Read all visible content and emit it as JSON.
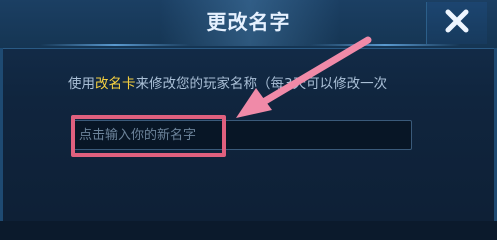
{
  "dialog": {
    "title": "更改名字",
    "close_icon": "close-icon",
    "description_prefix": "使用",
    "description_highlight": "改名卡",
    "description_suffix": "来修改您的玩家名称（每3天可以修改一次",
    "input": {
      "value": "",
      "placeholder": "点击输入你的新名字"
    }
  },
  "annotation": {
    "arrow_color": "#f08aa8",
    "box_color": "#e0607e"
  },
  "colors": {
    "highlight_text": "#f5d040",
    "title_text": "#e6f1ff"
  }
}
